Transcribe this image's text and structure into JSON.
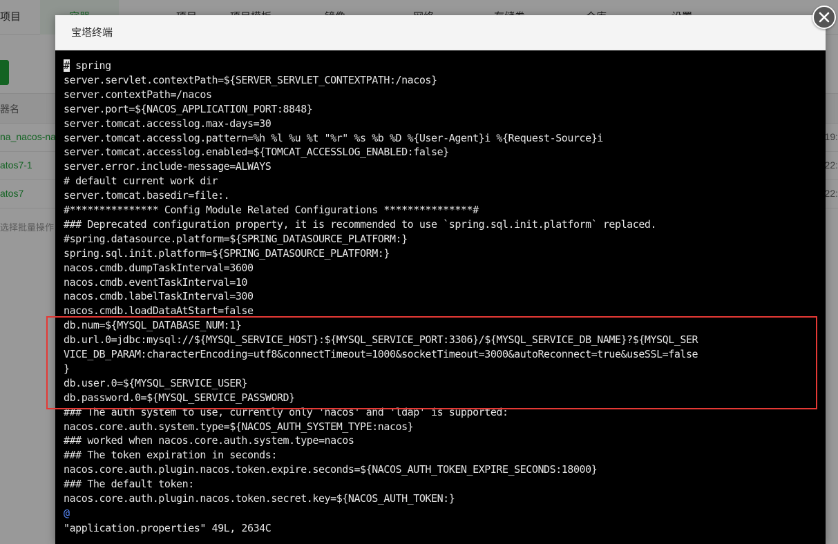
{
  "background": {
    "nav_items": [
      "项目",
      "容器",
      "项目",
      "项目模板",
      "镜像",
      "网络",
      "存储卷",
      "仓库",
      "设置"
    ],
    "table_header": "器名",
    "rows": [
      {
        "name": "na_nacos-na",
        "time": "19:"
      },
      {
        "name": "atos7-1",
        "time": "22:"
      },
      {
        "name": "atos7",
        "time": "22:"
      }
    ],
    "batch_placeholder": "选择批量操作"
  },
  "modal": {
    "title": "宝塔终端",
    "close_icon": "close-icon"
  },
  "terminal": {
    "cursor_char": "#",
    "first_line_rest": " spring",
    "lines": [
      "server.servlet.contextPath=${SERVER_SERVLET_CONTEXTPATH:/nacos}",
      "server.contextPath=/nacos",
      "server.port=${NACOS_APPLICATION_PORT:8848}",
      "server.tomcat.accesslog.max-days=30",
      "server.tomcat.accesslog.pattern=%h %l %u %t \"%r\" %s %b %D %{User-Agent}i %{Request-Source}i",
      "server.tomcat.accesslog.enabled=${TOMCAT_ACCESSLOG_ENABLED:false}",
      "server.error.include-message=ALWAYS",
      "# default current work dir",
      "server.tomcat.basedir=file:.",
      "#*************** Config Module Related Configurations ***************#",
      "### Deprecated configuration property, it is recommended to use `spring.sql.init.platform` replaced.",
      "#spring.datasource.platform=${SPRING_DATASOURCE_PLATFORM:}",
      "spring.sql.init.platform=${SPRING_DATASOURCE_PLATFORM:}",
      "nacos.cmdb.dumpTaskInterval=3600",
      "nacos.cmdb.eventTaskInterval=10",
      "nacos.cmdb.labelTaskInterval=300",
      "nacos.cmdb.loadDataAtStart=false",
      "db.num=${MYSQL_DATABASE_NUM:1}",
      "db.url.0=jdbc:mysql://${MYSQL_SERVICE_HOST}:${MYSQL_SERVICE_PORT:3306}/${MYSQL_SERVICE_DB_NAME}?${MYSQL_SER",
      "VICE_DB_PARAM:characterEncoding=utf8&connectTimeout=1000&socketTimeout=3000&autoReconnect=true&useSSL=false",
      "}",
      "db.user.0=${MYSQL_SERVICE_USER}",
      "db.password.0=${MYSQL_SERVICE_PASSWORD}",
      "### The auth system to use, currently only 'nacos' and 'ldap' is supported:",
      "nacos.core.auth.system.type=${NACOS_AUTH_SYSTEM_TYPE:nacos}",
      "### worked when nacos.core.auth.system.type=nacos",
      "### The token expiration in seconds:",
      "nacos.core.auth.plugin.nacos.token.expire.seconds=${NACOS_AUTH_TOKEN_EXPIRE_SECONDS:18000}",
      "### The default token:",
      "nacos.core.auth.plugin.nacos.token.secret.key=${NACOS_AUTH_TOKEN:}"
    ],
    "tilde_line": "@",
    "status_line": "\"application.properties\" 49L, 2634C"
  },
  "colors": {
    "accent_green": "#20a53a",
    "highlight_red": "#e53935",
    "terminal_bg": "#000000",
    "terminal_fg": "#e6e6e6"
  }
}
